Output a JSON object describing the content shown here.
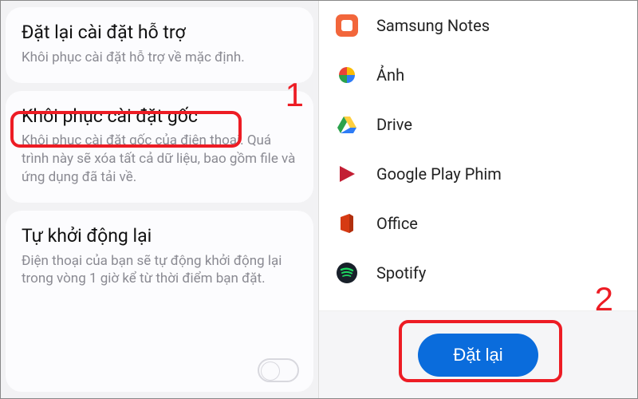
{
  "left": {
    "cards": [
      {
        "title": "Đặt lại cài đặt hỗ trợ",
        "desc": "Khôi phục cài đặt hỗ trợ về mặc định."
      },
      {
        "title": "Khôi phục cài đặt gốc",
        "desc": "Khôi phục cài đặt gốc của điện thoại. Quá trình này sẽ xóa tất cả dữ liệu, bao gồm file và ứng dụng đã tải về."
      },
      {
        "title": "Tự khởi động lại",
        "desc": "Điện thoại của bạn sẽ tự động khởi động lại trong vòng 1 giờ kể từ thời điểm bạn đặt."
      }
    ]
  },
  "right": {
    "apps": [
      {
        "name": "Samsung Notes"
      },
      {
        "name": "Ảnh"
      },
      {
        "name": "Drive"
      },
      {
        "name": "Google Play Phim"
      },
      {
        "name": "Office"
      },
      {
        "name": "Spotify"
      }
    ],
    "reset_label": "Đặt lại"
  },
  "annotations": {
    "one": "1",
    "two": "2"
  }
}
